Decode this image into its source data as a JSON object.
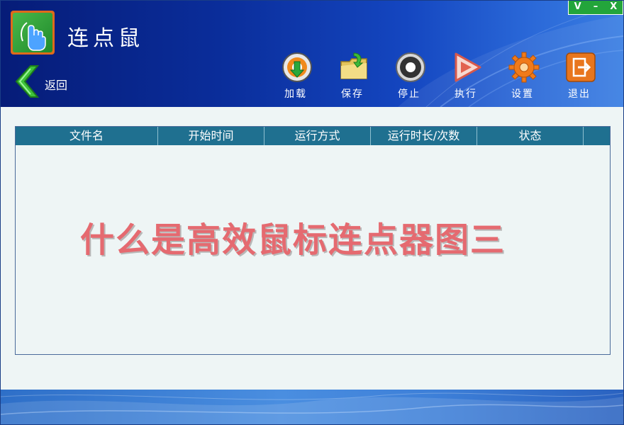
{
  "app": {
    "title": "连点鼠"
  },
  "window_controls": {
    "restore": "V",
    "minimize": "–",
    "close": "X"
  },
  "back": {
    "label": "返回"
  },
  "toolbar": [
    {
      "label": "加载",
      "icon": "load-icon"
    },
    {
      "label": "保存",
      "icon": "save-folder-icon"
    },
    {
      "label": "停止",
      "icon": "stop-icon"
    },
    {
      "label": "执行",
      "icon": "play-icon"
    },
    {
      "label": "设置",
      "icon": "gear-icon"
    },
    {
      "label": "退出",
      "icon": "exit-icon"
    }
  ],
  "table": {
    "columns": [
      "文件名",
      "开始时间",
      "运行方式",
      "运行时长/次数",
      "状态"
    ],
    "rows": []
  },
  "watermark": "什么是高效鼠标连点器图三",
  "colors": {
    "header_dark": "#061c78",
    "accent_green": "#23a53b",
    "table_header": "#1f7090",
    "watermark": "#e56a70"
  }
}
